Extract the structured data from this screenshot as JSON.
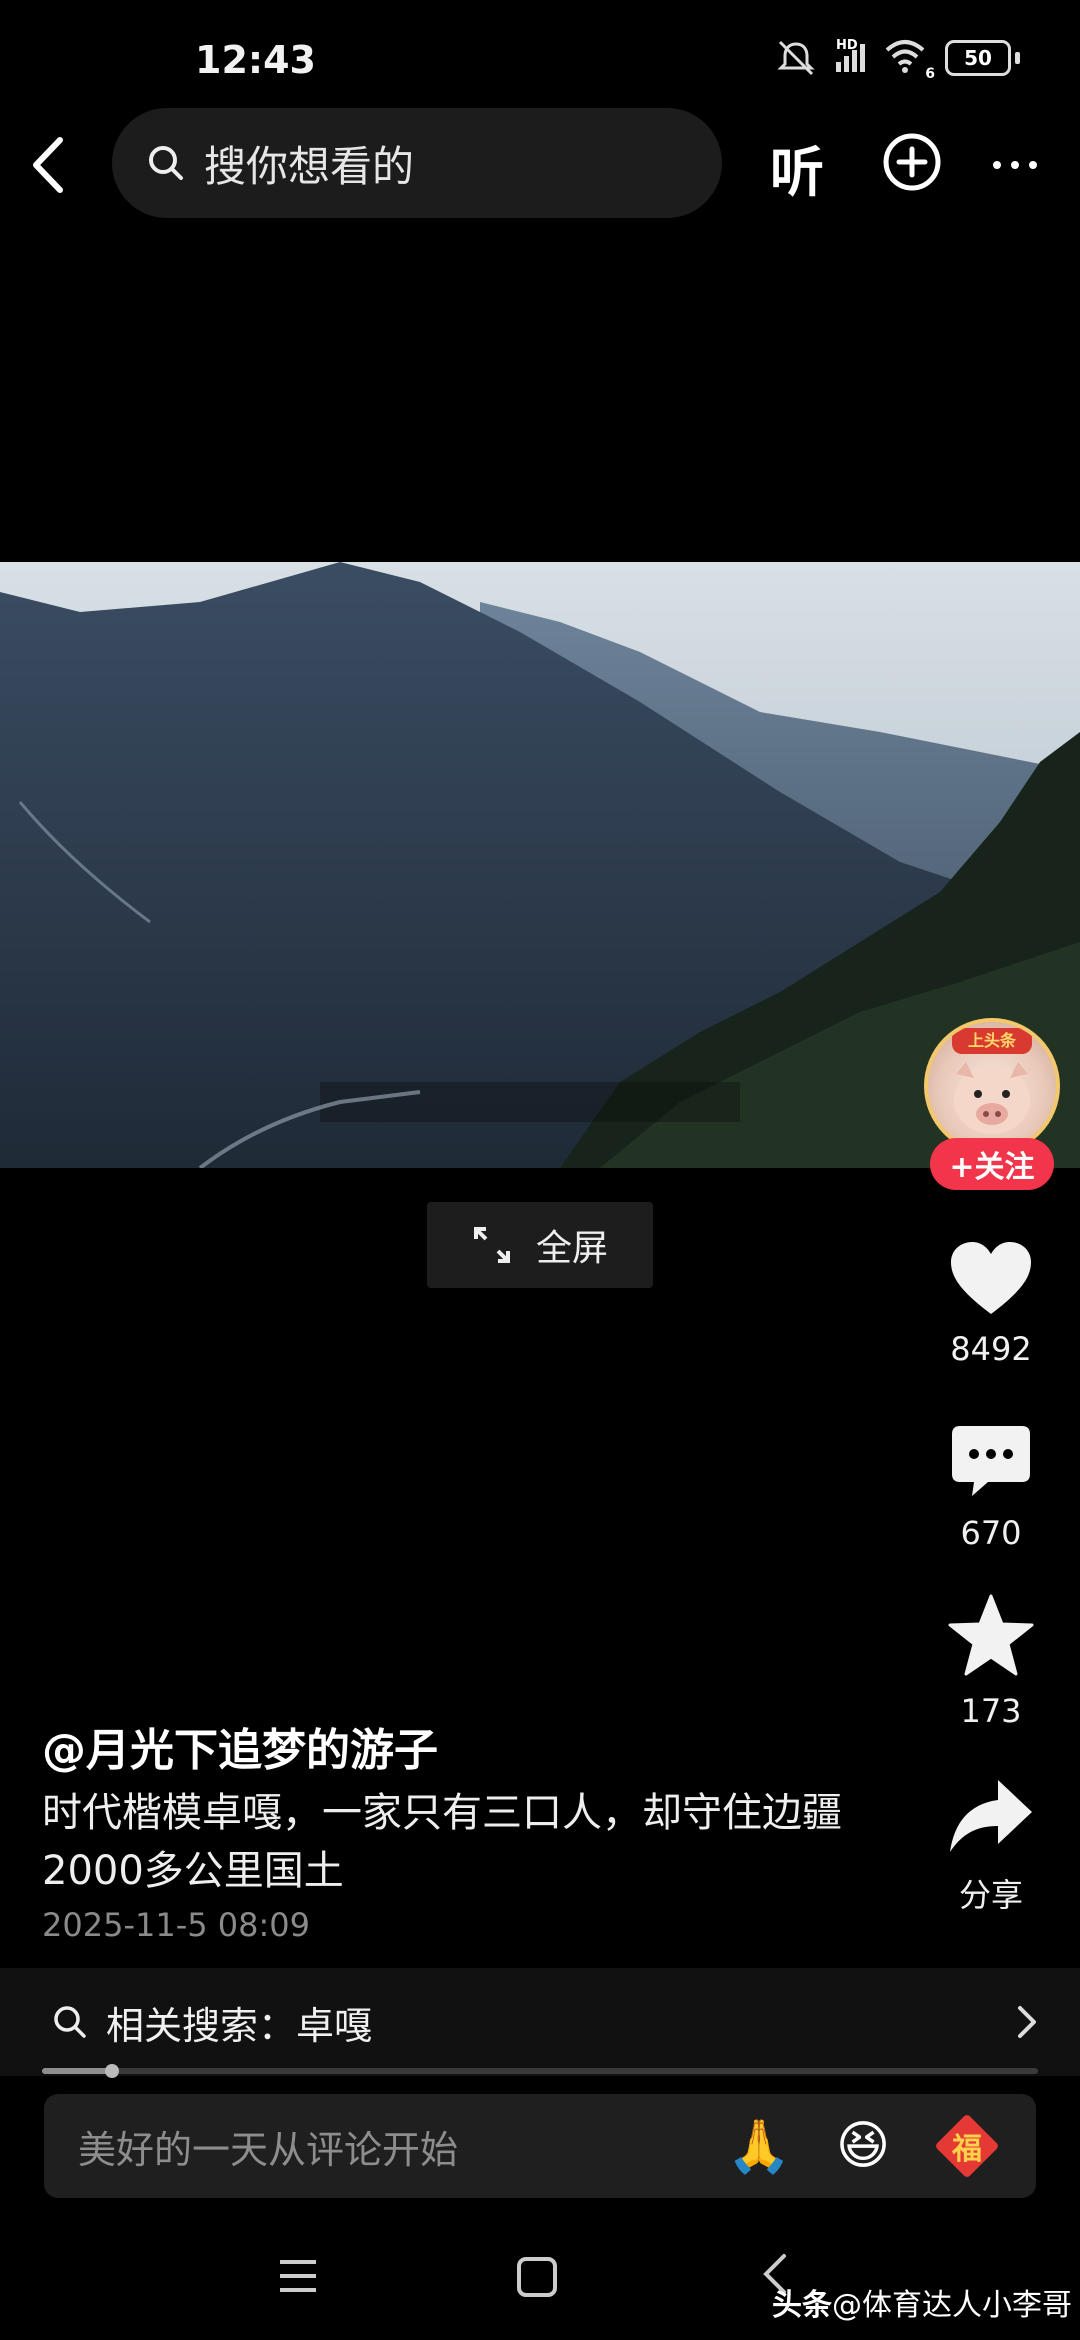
{
  "status_bar": {
    "time": "12:43",
    "network": "HD",
    "wifi": "6",
    "battery": "50"
  },
  "top_bar": {
    "search_placeholder": "搜你想看的",
    "listen_label": "听"
  },
  "video": {
    "fullscreen_label": "全屏"
  },
  "side_actions": {
    "follow_label": "+关注",
    "avatar_badge": "上头条",
    "likes": "8492",
    "comments": "670",
    "favorites": "173",
    "share_label": "分享"
  },
  "post": {
    "author": "@月光下追梦的游子",
    "caption": "时代楷模卓嘎，一家只有三口人，却守住边疆2000多公里国土",
    "timestamp": "2025-11-5 08:09"
  },
  "related_search": {
    "label": "相关搜索：卓嘎"
  },
  "playback": {
    "progress": 0.07
  },
  "comment_input": {
    "placeholder": "美好的一天从评论开始",
    "emoji_pray": "🙏",
    "emoji_laugh": "😆",
    "fu_char": "福"
  },
  "watermark": {
    "app": "头条",
    "author": "@体育达人小李哥"
  }
}
